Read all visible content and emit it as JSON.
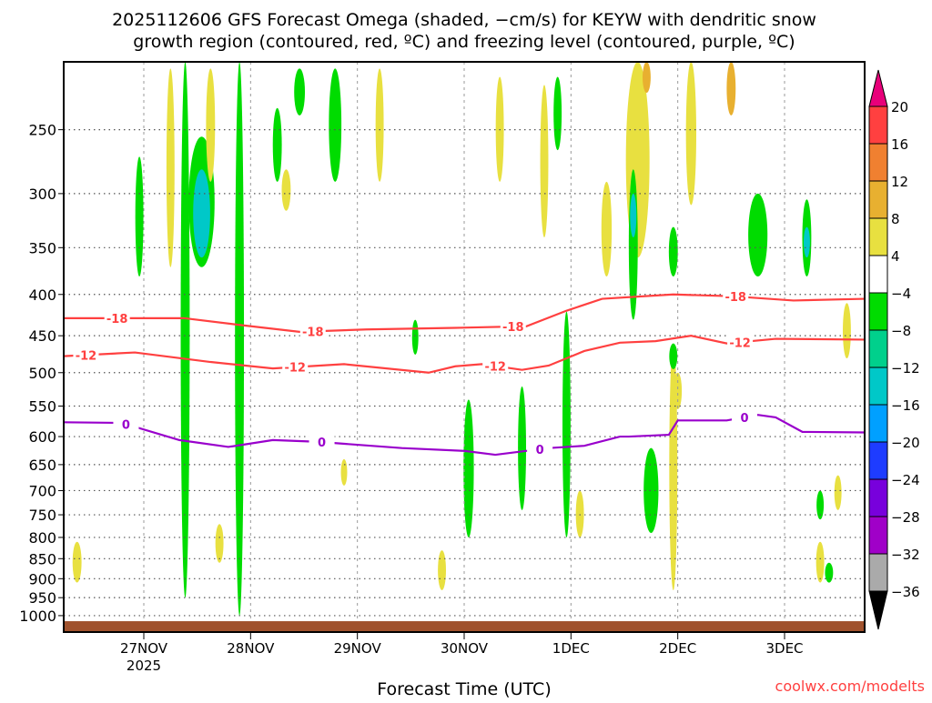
{
  "chart_data": {
    "type": "heatmap",
    "title_lines": [
      "2025112606 GFS Forecast Omega (shaded, −cm/s) for KEYW with dendritic snow",
      "growth region (contoured, red, ºC) and freezing level (contoured, purple, ºC)"
    ],
    "xlabel": "Forecast Time (UTC)",
    "ylabel": "",
    "credit": "coolwx.com/modelts",
    "x_units": "forecast hour from 2025-11-26 06Z",
    "xlim": [
      0,
      180
    ],
    "ylim_hPa": [
      206,
      1048
    ],
    "y_scale": "log",
    "x_ticks": [
      {
        "hour": 18,
        "label": "27NOV",
        "sublabel": "2025"
      },
      {
        "hour": 42,
        "label": "28NOV"
      },
      {
        "hour": 66,
        "label": "29NOV"
      },
      {
        "hour": 90,
        "label": "30NOV"
      },
      {
        "hour": 114,
        "label": "1DEC"
      },
      {
        "hour": 138,
        "label": "2DEC"
      },
      {
        "hour": 162,
        "label": "3DEC"
      }
    ],
    "y_ticks": [
      "250",
      "300",
      "350",
      "400",
      "450",
      "500",
      "550",
      "600",
      "650",
      "700",
      "750",
      "800",
      "850",
      "900",
      "950",
      "1000"
    ],
    "surface_pressure_hPa": 1016,
    "colorbar": {
      "levels": [
        "20",
        "16",
        "12",
        "8",
        "4",
        "-4",
        "-8",
        "-12",
        "-16",
        "-20",
        "-24",
        "-28",
        "-32",
        "-36"
      ],
      "colors": [
        "#ff4040",
        "#f08030",
        "#e8b030",
        "#e8e040",
        "#ffffff",
        "#00dc00",
        "#00d08c",
        "#00c8c8",
        "#00a0ff",
        "#1e3cff",
        "#7800dc",
        "#a000c8",
        "#aaaaaa"
      ],
      "over_color": "#e8007a",
      "under_color": "#000000"
    },
    "omega_patches": [
      {
        "hour": 27.3,
        "dh": 1.2,
        "p": [
          206,
          950
        ],
        "value": -6
      },
      {
        "hour": 31,
        "dh": 5,
        "p": [
          255,
          370
        ],
        "value": -6
      },
      {
        "hour": 31,
        "dh": 3,
        "p": [
          280,
          360
        ],
        "value": -14
      },
      {
        "hour": 39.5,
        "dh": 1.2,
        "p": [
          206,
          1000
        ],
        "value": -6
      },
      {
        "hour": 48,
        "dh": 1.2,
        "p": [
          235,
          290
        ],
        "value": -6
      },
      {
        "hour": 53,
        "dh": 1.6,
        "p": [
          210,
          240
        ],
        "value": -6
      },
      {
        "hour": 61,
        "dh": 2,
        "p": [
          210,
          290
        ],
        "value": -6
      },
      {
        "hour": 17,
        "dh": 1,
        "p": [
          270,
          380
        ],
        "value": -6
      },
      {
        "hour": 24,
        "dh": 1,
        "p": [
          210,
          370
        ],
        "value": 6
      },
      {
        "hour": 33,
        "dh": 1.2,
        "p": [
          210,
          290
        ],
        "value": 6
      },
      {
        "hour": 50,
        "dh": 1.2,
        "p": [
          280,
          315
        ],
        "value": 6
      },
      {
        "hour": 91,
        "dh": 1.5,
        "p": [
          540,
          800
        ],
        "value": -6
      },
      {
        "hour": 103,
        "dh": 1,
        "p": [
          520,
          740
        ],
        "value": -6
      },
      {
        "hour": 113,
        "dh": 1,
        "p": [
          420,
          800
        ],
        "value": -6
      },
      {
        "hour": 129,
        "dh": 4.5,
        "p": [
          206,
          360
        ],
        "value": 6
      },
      {
        "hour": 131,
        "dh": 1,
        "p": [
          206,
          225
        ],
        "value": 12
      },
      {
        "hour": 128,
        "dh": 1.2,
        "p": [
          280,
          430
        ],
        "value": -6
      },
      {
        "hour": 128,
        "dh": 0.6,
        "p": [
          300,
          340
        ],
        "value": -14
      },
      {
        "hour": 137,
        "dh": 1.2,
        "p": [
          330,
          380
        ],
        "value": -6
      },
      {
        "hour": 141,
        "dh": 1.5,
        "p": [
          206,
          310
        ],
        "value": 6
      },
      {
        "hour": 150,
        "dh": 1.2,
        "p": [
          206,
          240
        ],
        "value": 10
      },
      {
        "hour": 156,
        "dh": 3.5,
        "p": [
          300,
          380
        ],
        "value": -6
      },
      {
        "hour": 167,
        "dh": 1.2,
        "p": [
          305,
          380
        ],
        "value": -6
      },
      {
        "hour": 167,
        "dh": 0.6,
        "p": [
          330,
          360
        ],
        "value": -14
      },
      {
        "hour": 132,
        "dh": 2.5,
        "p": [
          620,
          790
        ],
        "value": -6
      },
      {
        "hour": 137,
        "dh": 1,
        "p": [
          460,
          930
        ],
        "value": 6
      },
      {
        "hour": 137,
        "dh": 1,
        "p": [
          460,
          495
        ],
        "value": -6
      },
      {
        "hour": 170,
        "dh": 1,
        "p": [
          810,
          910
        ],
        "value": 6
      },
      {
        "hour": 176,
        "dh": 1,
        "p": [
          410,
          480
        ],
        "value": 6
      },
      {
        "hour": 3,
        "dh": 1.2,
        "p": [
          810,
          910
        ],
        "value": 6
      },
      {
        "hour": 85,
        "dh": 1,
        "p": [
          830,
          930
        ],
        "value": 6
      },
      {
        "hour": 116,
        "dh": 1,
        "p": [
          700,
          800
        ],
        "value": 6
      },
      {
        "hour": 35,
        "dh": 1,
        "p": [
          770,
          860
        ],
        "value": 6
      },
      {
        "hour": 71,
        "dh": 1,
        "p": [
          210,
          290
        ],
        "value": 6
      },
      {
        "hour": 98,
        "dh": 1,
        "p": [
          215,
          290
        ],
        "value": 6
      },
      {
        "hour": 108,
        "dh": 1,
        "p": [
          220,
          340
        ],
        "value": 6
      },
      {
        "hour": 122,
        "dh": 1.5,
        "p": [
          290,
          380
        ],
        "value": 6
      },
      {
        "hour": 79,
        "dh": 0.6,
        "p": [
          430,
          475
        ],
        "value": -6
      },
      {
        "hour": 111,
        "dh": 1,
        "p": [
          215,
          265
        ],
        "value": -6
      },
      {
        "hour": 172,
        "dh": 1,
        "p": [
          860,
          910
        ],
        "value": -6
      },
      {
        "hour": 174,
        "dh": 0.8,
        "p": [
          670,
          740
        ],
        "value": 6
      },
      {
        "hour": 170,
        "dh": 0.8,
        "p": [
          700,
          760
        ],
        "value": -6
      },
      {
        "hour": 63,
        "dh": 0.6,
        "p": [
          640,
          690
        ],
        "value": 6
      },
      {
        "hour": 138,
        "dh": 1,
        "p": [
          500,
          555
        ],
        "value": 6
      }
    ],
    "contours": [
      {
        "level": "-18",
        "color": "#ff4040",
        "hours": [
          0,
          27,
          39,
          53,
          68,
          88,
          104,
          113,
          121,
          137,
          150,
          164,
          180
        ],
        "p": [
          428,
          428,
          436,
          445,
          442,
          440,
          438,
          419,
          405,
          400,
          402,
          407,
          405
        ],
        "label_hours": [
          12,
          56,
          101,
          151
        ]
      },
      {
        "level": "-12",
        "color": "#ff4040",
        "hours": [
          0,
          16,
          33,
          47,
          63,
          82,
          88,
          94,
          103,
          109,
          117,
          125,
          133,
          141,
          149,
          160,
          180
        ],
        "p": [
          477,
          472,
          485,
          494,
          488,
          500,
          491,
          488,
          496,
          490,
          470,
          459,
          457,
          450,
          460,
          454,
          455
        ],
        "label_hours": [
          5,
          52,
          97,
          152
        ]
      },
      {
        "level": "0",
        "color": "#9900cc",
        "hours": [
          0,
          13,
          26,
          37,
          47,
          57,
          76,
          90,
          97,
          109,
          117,
          125,
          127,
          136,
          138,
          149,
          156,
          160,
          166,
          180
        ],
        "p": [
          576,
          577,
          606,
          618,
          606,
          609,
          620,
          625,
          632,
          620,
          616,
          600,
          600,
          597,
          573,
          573,
          564,
          568,
          592,
          593
        ],
        "label_hours": [
          14,
          58,
          107,
          153
        ]
      }
    ]
  }
}
